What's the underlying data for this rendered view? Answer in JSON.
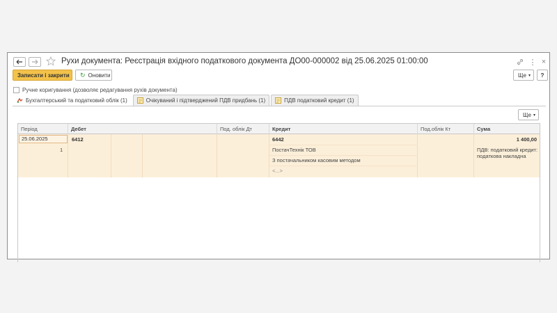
{
  "window": {
    "title": "Рухи документа: Реєстрація вхідного податкового документа ДО00-000002 від 25.06.2025 01:00:00"
  },
  "toolbar": {
    "save_close_label": "Записати і закрити",
    "refresh_label": "Оновити",
    "more_label": "Ще",
    "help_label": "?"
  },
  "manual_edit": {
    "label": "Ручне коригування (дозволяє редагування рухів документа)",
    "checked": false
  },
  "tabs": [
    {
      "label": "Бухгалтерський та податковий облік (1)",
      "active": true
    },
    {
      "label": "Очікуваний і підтверджений ПДВ придбань (1)",
      "active": false
    },
    {
      "label": "ПДВ податковий кредит (1)",
      "active": false
    }
  ],
  "panel": {
    "more_label": "Ще"
  },
  "table": {
    "columns": [
      "Період",
      "Дебет",
      "Под. облік Дт",
      "Кредит",
      "Под.облік Кт",
      "Сума"
    ],
    "rows": [
      {
        "period": "25.06.2025",
        "line_no": "1",
        "debit": "6412",
        "credit": "6442",
        "credit_sub1": "ПостачТехнік ТОВ",
        "credit_sub2": "З постачальником касовим методом",
        "credit_sub3": "<...>",
        "amount": "1 400,00",
        "amount_note": "ПДВ: податковий кредит: податкова накладна"
      }
    ]
  },
  "colors": {
    "accent": "#f3c24a",
    "row_selected": "#fcefd9"
  }
}
